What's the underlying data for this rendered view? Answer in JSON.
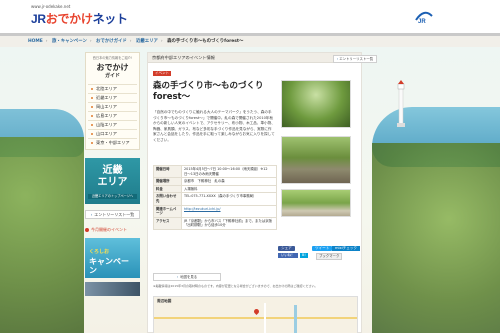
{
  "header": {
    "url": "www.jr-odekake.net",
    "logo_prefix": "JR",
    "logo_mid": "おでかけ",
    "logo_suffix": "ネット"
  },
  "breadcrumb": {
    "home": "HOME",
    "items": [
      "旅・キャンペーン",
      "おでかけガイド",
      "近畿エリア"
    ],
    "current": "森の手づくり市〜ものづくりforest〜"
  },
  "sidebar": {
    "intro": "西日本の魅力情報をご紹介!",
    "guide_title_top": "おでかけ",
    "guide_title_bottom": "ガイド",
    "areas": [
      "北陸エリア",
      "近畿エリア",
      "岡山エリア",
      "広島エリア",
      "山陰エリア",
      "山口エリア",
      "東京・中部エリア"
    ],
    "kinki_big_1": "近畿",
    "kinki_big_2": "エリア",
    "kinki_sub": "近畿エリアのトップページへ",
    "entry_button": "エントリーリスト一覧",
    "promo": "今月開催のイベント",
    "kuroshio_top": "くろしお",
    "kuroshio_main": "くろしお",
    "kuroshio_sub": "キャンペーン"
  },
  "main": {
    "panel_heading": "京都府中部エリアのイベント情報",
    "badge": "イベント",
    "title": "森の手づくり市〜ものづくりforest〜",
    "description": "「自然の中でものづくりに触れる大人のテーマパーク」をうたう、森の手づくり市〜ものづくりforest〜」で開催中。糺の森で開催された2010年秋からの新しい人気のイベントで、アクセサリー、布小物、木工品、革小物、陶器、家具類、ガラス、布など多彩な手づくり作品を見ながら、実際に作家さんと会話をしたり、作品を手に取って楽しみながらお気に入りを探してください。",
    "entry_button": "エントリーリスト一覧",
    "table": [
      {
        "k": "開催日時",
        "v": "2015年4月5日〜7日 10:00〜16:00（雨天順延）※12日〜13日のみ雨天開催"
      },
      {
        "k": "開催場所",
        "v": "京都市　下鴨神社　糺の森"
      },
      {
        "k": "料金",
        "v": "入場無料"
      },
      {
        "k": "お問い合わせ先",
        "v": "TEL:075-771-XXXX（森の手づくり市事務局）"
      },
      {
        "k": "関連ホームページ",
        "v": "http://tezukuri-ichi.jp/"
      },
      {
        "k": "アクセス",
        "v": "JR「京都駅」から市バス「下鴨神社前」まで。または京阪「出町柳駅」から徒歩10分"
      }
    ],
    "map_entry": "地図を見る",
    "note": "※掲載情報は2015年3月の取材時のものです。内容が変更となる場合がございますので、お出かけの際はご確認ください。",
    "map_label": "周辺地図"
  },
  "social": {
    "facebook": "シェア",
    "twitter": "ツイート",
    "mixi": "mixiチェック",
    "like": "いいね！",
    "hatena": "B!",
    "bookmark": "ブックマーク"
  },
  "colors": {
    "brand_blue": "#1b3e9a",
    "brand_red": "#e8432e",
    "kinki_teal": "#1f7c8b",
    "badge_red": "#d23c2a"
  }
}
